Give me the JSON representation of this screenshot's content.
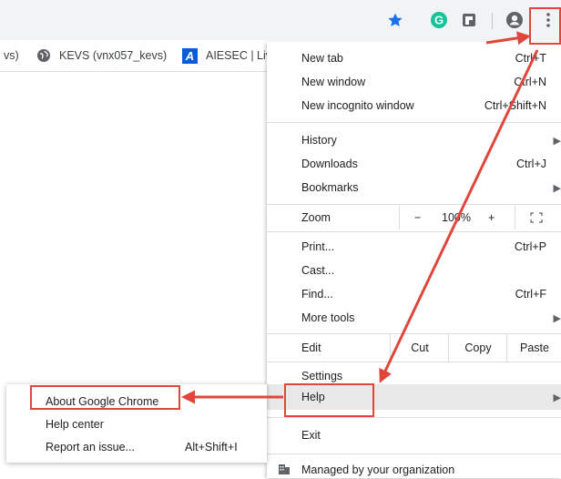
{
  "toolbar": {
    "icons": [
      "star-icon",
      "grammarly-icon",
      "extension-icon",
      "account-icon",
      "more-vert-icon"
    ],
    "grammarly_letter": "G"
  },
  "bookmarks": [
    {
      "label": "vs)",
      "icon": null
    },
    {
      "label": "KEVS (vnx057_kevs)",
      "icon": "globe-icon"
    },
    {
      "label": "AIESEC | Liv",
      "icon": "aiesec-icon",
      "icon_letter": "A"
    }
  ],
  "menu": {
    "new_tab": {
      "label": "New tab",
      "shortcut": "Ctrl+T"
    },
    "new_window": {
      "label": "New window",
      "shortcut": "Ctrl+N"
    },
    "new_incognito": {
      "label": "New incognito window",
      "shortcut": "Ctrl+Shift+N"
    },
    "history": {
      "label": "History"
    },
    "downloads": {
      "label": "Downloads",
      "shortcut": "Ctrl+J"
    },
    "bookmarks": {
      "label": "Bookmarks"
    },
    "zoom": {
      "label": "Zoom",
      "minus": "−",
      "value": "100%",
      "plus": "+"
    },
    "print": {
      "label": "Print...",
      "shortcut": "Ctrl+P"
    },
    "cast": {
      "label": "Cast..."
    },
    "find": {
      "label": "Find...",
      "shortcut": "Ctrl+F"
    },
    "more_tools": {
      "label": "More tools"
    },
    "edit": {
      "label": "Edit",
      "cut": "Cut",
      "copy": "Copy",
      "paste": "Paste"
    },
    "settings": {
      "label": "Settings"
    },
    "help": {
      "label": "Help"
    },
    "exit": {
      "label": "Exit"
    },
    "managed": {
      "label": "Managed by your organization"
    }
  },
  "help_submenu": {
    "about": {
      "label": "About Google Chrome"
    },
    "help_center": {
      "label": "Help center"
    },
    "report": {
      "label": "Report an issue...",
      "shortcut": "Alt+Shift+I"
    }
  },
  "colors": {
    "annotation_red": "#e0463c",
    "star_blue": "#1a73e8",
    "grammarly_green": "#15c39a",
    "aiesec_blue": "#0a5cd5"
  }
}
